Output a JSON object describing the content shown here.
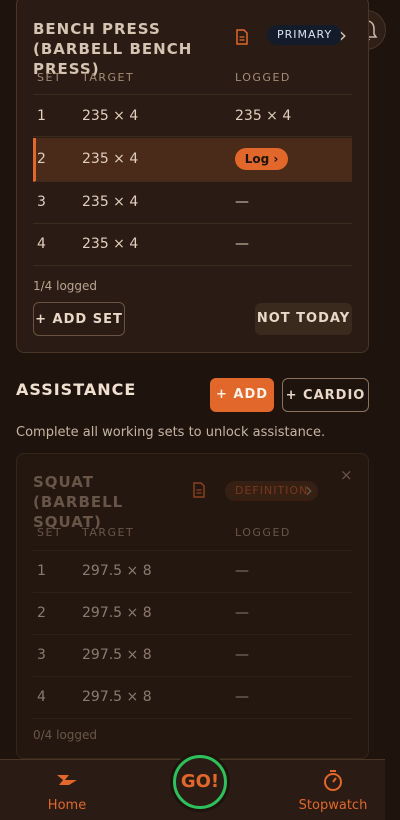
{
  "bench": {
    "title": "BENCH PRESS (BARBELL BENCH PRESS)",
    "badge": "PRIMARY",
    "headers": {
      "set": "SET",
      "target": "TARGET",
      "logged": "LOGGED"
    },
    "rows": [
      {
        "set": "1",
        "target": "235 × 4",
        "logged": "235 × 4"
      },
      {
        "set": "2",
        "target": "235 × 4",
        "logged": "Log ›"
      },
      {
        "set": "3",
        "target": "235 × 4",
        "logged": "—"
      },
      {
        "set": "4",
        "target": "235 × 4",
        "logged": "—"
      }
    ],
    "logged_count": "1/4 logged",
    "add_set_label": "+ ADD SET",
    "not_today_label": "NOT TODAY"
  },
  "assistance": {
    "title": "ASSISTANCE",
    "add_label": "+ ADD",
    "cardio_label": "+ CARDIO",
    "hint": "Complete all working sets to unlock assistance."
  },
  "squat": {
    "title": "SQUAT (BARBELL SQUAT)",
    "badge": "DEFINITION",
    "close": "×",
    "headers": {
      "set": "SET",
      "target": "TARGET",
      "logged": "LOGGED"
    },
    "rows": [
      {
        "set": "1",
        "target": "297.5 × 8",
        "logged": "—"
      },
      {
        "set": "2",
        "target": "297.5 × 8",
        "logged": "—"
      },
      {
        "set": "3",
        "target": "297.5 × 8",
        "logged": "—"
      },
      {
        "set": "4",
        "target": "297.5 × 8",
        "logged": "—"
      }
    ],
    "logged_count": "0/4 logged"
  },
  "nav": {
    "home_label": "Home",
    "go_label": "GO!",
    "stopwatch_label": "Stopwatch"
  },
  "icons": {
    "bell": "bell-icon",
    "doc": "document-icon",
    "chevron": "chevron-right-icon",
    "home": "barbell-home-icon",
    "stopwatch": "stopwatch-icon"
  },
  "colors": {
    "accent": "#e2672a",
    "background": "#1e130d",
    "card": "#2a1c14",
    "go_ring": "#2ec05a"
  }
}
